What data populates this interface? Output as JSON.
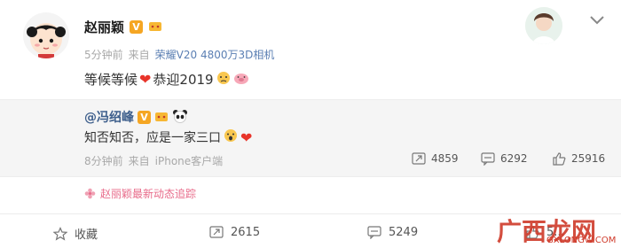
{
  "post": {
    "author": "赵丽颖",
    "verified_badge": "V",
    "time": "5分钟前",
    "source_prefix": "来自",
    "source": "荣耀V20 4800万3D相机",
    "text_1": "等候等候",
    "text_2": "恭迎2019",
    "icons": [
      "avatar-cartoon-girl-icon",
      "verified-v-icon",
      "crown-emoji-icon",
      "heart-icon",
      "crying-emoji-icon",
      "pig-emoji-icon"
    ]
  },
  "header": {
    "chevron_icon": "chevron-down-icon"
  },
  "repost": {
    "author": "@冯绍峰",
    "verified_badge": "V",
    "text": "知否知否，应是一家三口",
    "time": "8分钟前",
    "source_prefix": "来自",
    "source": "iPhone客户端",
    "reposts": "4859",
    "comments": "6292",
    "likes": "25916"
  },
  "topic": {
    "text": "赵丽颖最新动态追踪"
  },
  "toolbar": {
    "favorite_label": "收藏",
    "repost_count": "2615",
    "comment_count": "5249",
    "like_count": "5..."
  },
  "watermark": {
    "text": "广西龙网",
    "url": "GXLONGW.COM"
  },
  "colors": {
    "accent_link": "#3e5f8c",
    "heart": "#e8342a",
    "topic_pink": "#e86b8a",
    "badge_gold": "#f5a623"
  }
}
